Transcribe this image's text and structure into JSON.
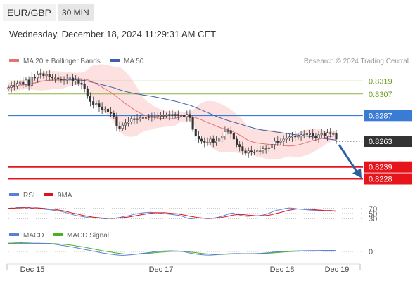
{
  "header": {
    "pair": "EUR/GBP",
    "timeframe": "30 MIN",
    "datetime": "Wednesday, December 18, 2024 11:29:31 AM CET"
  },
  "copyright": "Research © 2024 Trading Central",
  "colors": {
    "ma20": "#e57373",
    "band_fill": "#fde0e0",
    "ma50": "#3f5fa8",
    "resistance": "#8db23f",
    "pivot": "#3a7bd5",
    "current": "#333333",
    "support": "#e8141b",
    "arrow": "#2f5f9e",
    "rsi": "#5b7fd9",
    "rsi_ma": "#d9141b",
    "macd": "#5b7fd9",
    "macd_signal": "#4caf2a"
  },
  "chart_data": [
    {
      "type": "candlestick",
      "legend": [
        {
          "label": "MA 20 + Bollinger Bands",
          "color": "#e57373"
        },
        {
          "label": "MA 50",
          "color": "#3f5fa8"
        }
      ],
      "ylim": [
        0.82244,
        0.83291
      ],
      "x_labels": [
        "Dec 15",
        "Dec 17",
        "Dec 18",
        "Dec 19"
      ],
      "levels": [
        {
          "value": 0.8319,
          "label": "0.8319",
          "role": "resistance"
        },
        {
          "value": 0.8307,
          "label": "0.8307",
          "role": "resistance"
        },
        {
          "value": 0.8287,
          "label": "0.8287",
          "role": "pivot"
        },
        {
          "value": 0.8263,
          "label": "0.8263",
          "role": "current"
        },
        {
          "value": 0.8239,
          "label": "0.8239",
          "role": "support"
        },
        {
          "value": 0.8228,
          "label": "0.8228",
          "role": "support"
        }
      ],
      "close": [
        0.8313,
        0.8315,
        0.8314,
        0.8317,
        0.8318,
        0.8316,
        0.832,
        0.8315,
        0.8323,
        0.8322,
        0.8325,
        0.8326,
        0.8324,
        0.8325,
        0.8323,
        0.8322,
        0.8322,
        0.8321,
        0.832,
        0.832,
        0.8321,
        0.8322,
        0.8319,
        0.832,
        0.8317,
        0.8316,
        0.8312,
        0.8305,
        0.83,
        0.8297,
        0.8298,
        0.8295,
        0.8292,
        0.8293,
        0.829,
        0.8289,
        0.8286,
        0.8277,
        0.8275,
        0.8278,
        0.828,
        0.8281,
        0.8284,
        0.8283,
        0.8284,
        0.8285,
        0.8285,
        0.8285,
        0.8286,
        0.8286,
        0.8286,
        0.8287,
        0.8287,
        0.8287,
        0.8287,
        0.8288,
        0.8287,
        0.8288,
        0.8287,
        0.8287,
        0.8286,
        0.8288,
        0.8285,
        0.8274,
        0.8268,
        0.8265,
        0.8263,
        0.8262,
        0.8262,
        0.8265,
        0.8262,
        0.8263,
        0.8266,
        0.8268,
        0.8272,
        0.8273,
        0.827,
        0.8265,
        0.826,
        0.8258,
        0.8254,
        0.8252,
        0.8254,
        0.8253,
        0.8253,
        0.8254,
        0.8254,
        0.8256,
        0.8256,
        0.8257,
        0.826,
        0.8263,
        0.8262,
        0.8263,
        0.8265,
        0.8266,
        0.8267,
        0.8268,
        0.8267,
        0.8268,
        0.8269,
        0.8269,
        0.827,
        0.827,
        0.8268,
        0.8266,
        0.8269,
        0.827,
        0.8268,
        0.8271,
        0.827,
        0.827,
        0.8265
      ]
    },
    {
      "type": "line",
      "legend": [
        {
          "label": "RSI",
          "color": "#5b7fd9"
        },
        {
          "label": "9MA",
          "color": "#d9141b"
        }
      ],
      "ylim": [
        0,
        100
      ],
      "y_ticks": [
        {
          "value": 70,
          "label": "70"
        },
        {
          "value": 50,
          "label": "50"
        },
        {
          "value": 30,
          "label": "30"
        }
      ],
      "series": [
        {
          "name": "RSI",
          "values": [
            70,
            72,
            69,
            75,
            73,
            76,
            71,
            74,
            68,
            73,
            72,
            70,
            67,
            66,
            65,
            63,
            62,
            60,
            58,
            55,
            52,
            48,
            45,
            42,
            40,
            38,
            36,
            34,
            33,
            32,
            34,
            31,
            30,
            29,
            31,
            30,
            32,
            33,
            35,
            38,
            40,
            42,
            45,
            48,
            50,
            52,
            53,
            54,
            55,
            54,
            53,
            52,
            50,
            49,
            48,
            47,
            45,
            44,
            42,
            39,
            34,
            30,
            29,
            31,
            33,
            32,
            31,
            30,
            30,
            31,
            33,
            35,
            38,
            42,
            46,
            50,
            52,
            48,
            45,
            42,
            40,
            39,
            40,
            41,
            40,
            42,
            44,
            46,
            50,
            55,
            60,
            63,
            65,
            68,
            70,
            72,
            71,
            70,
            68,
            67,
            66,
            65,
            64,
            63,
            62,
            62,
            61,
            60,
            61,
            62,
            60,
            58
          ]
        },
        {
          "name": "9MA",
          "values": [
            70,
            71,
            71,
            72,
            72,
            73,
            73,
            73,
            72,
            72,
            72,
            71,
            70,
            69,
            68,
            67,
            66,
            64,
            62,
            60,
            57,
            54,
            51,
            49,
            46,
            43,
            41,
            39,
            37,
            35,
            34,
            33,
            32,
            31,
            31,
            31,
            31,
            32,
            33,
            34,
            35,
            37,
            39,
            41,
            43,
            45,
            47,
            49,
            51,
            52,
            53,
            53,
            53,
            53,
            52,
            51,
            50,
            49,
            47,
            45,
            43,
            40,
            38,
            36,
            34,
            33,
            32,
            31,
            31,
            31,
            32,
            33,
            34,
            36,
            38,
            41,
            44,
            45,
            46,
            46,
            45,
            44,
            43,
            42,
            41,
            41,
            41,
            42,
            43,
            45,
            48,
            51,
            54,
            57,
            60,
            63,
            65,
            67,
            68,
            68,
            68,
            68,
            67,
            66,
            65,
            64,
            63,
            62,
            62,
            62,
            61,
            60
          ]
        }
      ]
    },
    {
      "type": "line",
      "legend": [
        {
          "label": "MACD",
          "color": "#5b7fd9"
        },
        {
          "label": "MACD Signal",
          "color": "#4caf2a"
        }
      ],
      "y_ticks": [
        {
          "value": 0,
          "label": "0"
        }
      ],
      "ylim": [
        -0.0011,
        0.0011
      ],
      "series": [
        {
          "name": "MACD",
          "values": [
            0.0008,
            0.0008,
            0.00079,
            0.00078,
            0.00077,
            0.00076,
            0.00075,
            0.00074,
            0.00073,
            0.00072,
            0.00072,
            0.00071,
            0.0007,
            0.00069,
            0.00068,
            0.00066,
            0.00062,
            0.00058,
            0.00054,
            0.0005,
            0.00046,
            0.00042,
            0.00038,
            0.00033,
            0.00028,
            0.00023,
            0.00018,
            0.00013,
            8e-05,
            3e-05,
            -2e-05,
            -7e-05,
            -0.00012,
            -0.00016,
            -0.0002,
            -0.00024,
            -0.00027,
            -0.0003,
            -0.00032,
            -0.00033,
            -0.00032,
            -0.0003,
            -0.00028,
            -0.00025,
            -0.00022,
            -0.00018,
            -0.00015,
            -0.00012,
            -9e-05,
            -6e-05,
            -3e-05,
            0.0,
            2e-05,
            4e-05,
            5e-05,
            6e-05,
            6e-05,
            5e-05,
            4e-05,
            2e-05,
            -2e-05,
            -8e-05,
            -0.00014,
            -0.00018,
            -0.00022,
            -0.00025,
            -0.00028,
            -0.0003,
            -0.00031,
            -0.00031,
            -0.0003,
            -0.00028,
            -0.00026,
            -0.00024,
            -0.00022,
            -0.0002,
            -0.00019,
            -0.00018,
            -0.00018,
            -0.00018,
            -0.00019,
            -0.00019,
            -0.00019,
            -0.00019,
            -0.00018,
            -0.00017,
            -0.00016,
            -0.00014,
            -0.00012,
            -0.0001,
            -7e-05,
            -5e-05,
            -3e-05,
            -1e-05,
            1e-05,
            2e-05,
            3e-05,
            4e-05,
            5e-05,
            6e-05,
            6e-05,
            7e-05,
            7e-05,
            8e-05,
            8e-05,
            8e-05,
            8e-05,
            9e-05,
            9e-05,
            9e-05,
            9e-05,
            9e-05,
            8e-05
          ]
        },
        {
          "name": "MACD Signal",
          "values": [
            0.0007,
            0.0007,
            0.0007,
            0.00071,
            0.00071,
            0.00071,
            0.00071,
            0.00071,
            0.00071,
            0.00071,
            0.00071,
            0.00071,
            0.00071,
            0.0007,
            0.0007,
            0.00069,
            0.00068,
            0.00066,
            0.00064,
            0.00062,
            0.00059,
            0.00056,
            0.00053,
            0.00049,
            0.00045,
            0.00041,
            0.00037,
            0.00032,
            0.00027,
            0.00022,
            0.00017,
            0.00012,
            7e-05,
            3e-05,
            -1e-05,
            -5e-05,
            -9e-05,
            -0.00013,
            -0.00016,
            -0.00019,
            -0.00021,
            -0.00022,
            -0.00023,
            -0.00023,
            -0.00022,
            -0.00021,
            -0.00019,
            -0.00017,
            -0.00015,
            -0.00013,
            -0.00011,
            -8e-05,
            -6e-05,
            -4e-05,
            -2e-05,
            0.0,
            1e-05,
            2e-05,
            2e-05,
            2e-05,
            1e-05,
            -1e-05,
            -4e-05,
            -7e-05,
            -0.0001,
            -0.00013,
            -0.00016,
            -0.00019,
            -0.00021,
            -0.00023,
            -0.00024,
            -0.00025,
            -0.00025,
            -0.00025,
            -0.00024,
            -0.00023,
            -0.00022,
            -0.00021,
            -0.0002,
            -0.00019,
            -0.00019,
            -0.00019,
            -0.00019,
            -0.00019,
            -0.00019,
            -0.00018,
            -0.00018,
            -0.00017,
            -0.00016,
            -0.00014,
            -0.00013,
            -0.00011,
            -9e-05,
            -7e-05,
            -5e-05,
            -3e-05,
            -2e-05,
            0.0,
            1e-05,
            2e-05,
            3e-05,
            4e-05,
            5e-05,
            6e-05,
            6e-05,
            7e-05,
            7e-05,
            8e-05,
            8e-05,
            8e-05,
            8e-05,
            8e-05,
            8e-05
          ]
        }
      ]
    }
  ]
}
